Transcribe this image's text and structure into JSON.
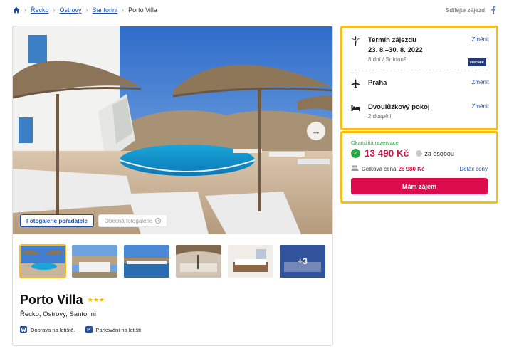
{
  "breadcrumb": {
    "items": [
      "Řecko",
      "Ostrovy",
      "Santorini"
    ],
    "current": "Porto Villa"
  },
  "share_label": "Sdílejte zájezd",
  "gallery": {
    "tabs": [
      "Fotogalerie pořadatele",
      "Obecná fotogalerie"
    ],
    "more_photos": "+3"
  },
  "hotel": {
    "name": "Porto Villa",
    "stars": "★★★",
    "location": "Řecko, Ostrovy, Santorini",
    "amenities": [
      {
        "icon": "bus-icon",
        "label": "Doprava na letiště."
      },
      {
        "icon": "parking-icon",
        "label": "Parkování na letišti"
      }
    ]
  },
  "trip": {
    "term_title": "Termín zájezdu",
    "term_dates": "23. 8.–30. 8. 2022",
    "term_detail": "8 dní / Snídaně",
    "change_label": "Změnit",
    "operator_logo": "FISCHER",
    "departure": "Praha",
    "room": "Dvoulůžkový pokoj",
    "guests": "2 dospělí"
  },
  "price": {
    "instant": "Okamžitá rezervace",
    "amount": "13 490 Kč",
    "per_person": "za osobou",
    "total_label": "Celková cena",
    "total": "26 980 Kč",
    "detail": "Detail ceny",
    "cta": "Mám zájem"
  },
  "colors": {
    "accent_blue": "#1d4fa6",
    "price_red": "#d61448",
    "cta_red": "#dd0c4c",
    "highlight_yellow": "#f7bd19",
    "success_green": "#28a745"
  }
}
